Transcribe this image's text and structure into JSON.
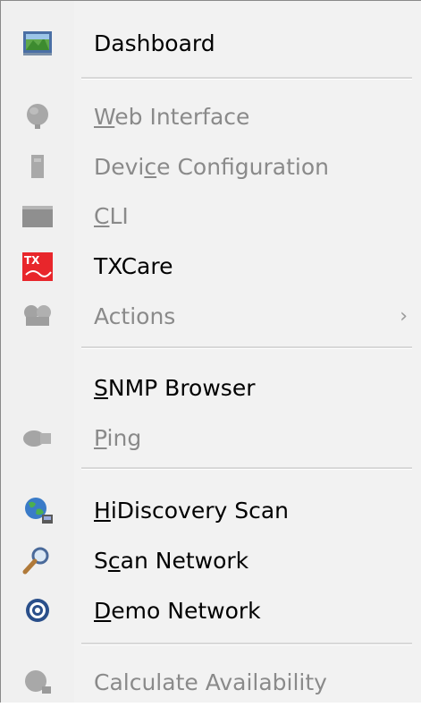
{
  "menu": {
    "items": [
      {
        "label": "Dashboard",
        "ul_pre": "",
        "ul": "",
        "ul_post": "Dashboard",
        "icon": "dashboard-icon",
        "enabled": true
      },
      {
        "label": "Web Interface",
        "ul_pre": "",
        "ul": "W",
        "ul_post": "eb Interface",
        "icon": "globe-icon",
        "enabled": false
      },
      {
        "label": "Device Configuration",
        "ul_pre": "Devi",
        "ul": "c",
        "ul_post": "e Configuration",
        "icon": "device-icon",
        "enabled": false
      },
      {
        "label": "CLI",
        "ul_pre": "",
        "ul": "C",
        "ul_post": "LI",
        "icon": "terminal-icon",
        "enabled": false
      },
      {
        "label": "TXCare",
        "ul_pre": "",
        "ul": "",
        "ul_post": "TXCare",
        "icon": "txcare-icon",
        "enabled": true
      },
      {
        "label": "Actions",
        "ul_pre": "",
        "ul": "",
        "ul_post": "Actions",
        "icon": "actions-icon",
        "enabled": false,
        "submenu_arrow": "›"
      },
      {
        "label": "SNMP Browser",
        "ul_pre": "",
        "ul": "S",
        "ul_post": "NMP Browser",
        "icon": "",
        "enabled": true
      },
      {
        "label": "Ping",
        "ul_pre": "",
        "ul": "P",
        "ul_post": "ing",
        "icon": "ping-icon",
        "enabled": false
      },
      {
        "label": "HiDiscovery Scan",
        "ul_pre": "",
        "ul": "H",
        "ul_post": "iDiscovery Scan",
        "icon": "hidiscovery-globe-icon",
        "enabled": true
      },
      {
        "label": "Scan Network",
        "ul_pre": "S",
        "ul": "c",
        "ul_post": "an Network",
        "icon": "magnifier-icon",
        "enabled": true
      },
      {
        "label": "Demo Network",
        "ul_pre": "",
        "ul": "D",
        "ul_post": "emo Network",
        "icon": "demo-network-icon",
        "enabled": true
      },
      {
        "label": "Calculate Availability",
        "ul_pre": "",
        "ul": "",
        "ul_post": "Calculate Availability",
        "icon": "availability-icon",
        "enabled": false
      }
    ]
  },
  "colors": {
    "menu_background": "#f2f2f2",
    "enabled_text": "#000000",
    "disabled_text": "#8a8a8a",
    "txcare_red": "#e8262b"
  }
}
